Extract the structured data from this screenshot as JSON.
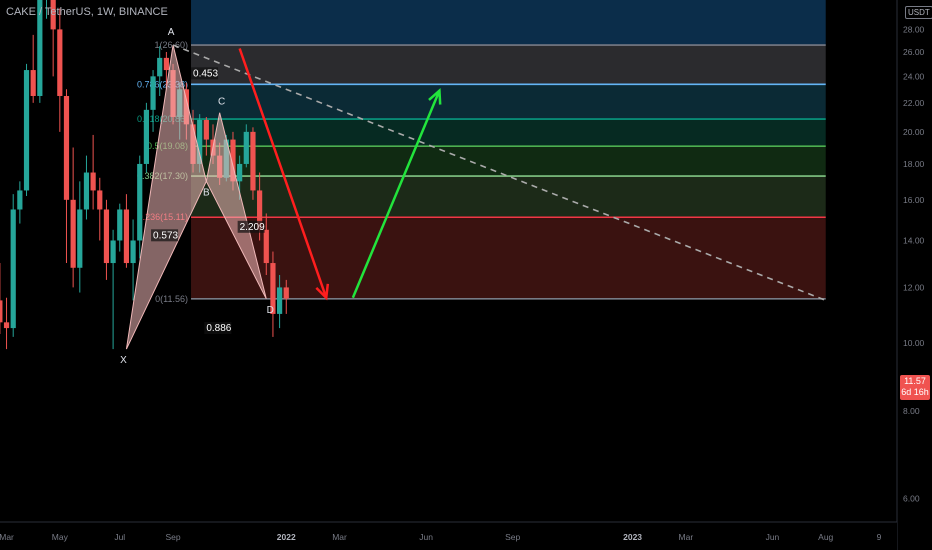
{
  "header": {
    "symbol": "CAKE / TetherUS, 1W, BINANCE"
  },
  "price_axis": {
    "currency": "USDT",
    "current_price": "11.57",
    "countdown": "6d 16h"
  },
  "chart_data": {
    "type": "candlestick",
    "ylim": [
      5.0,
      28.5
    ],
    "y_ticks": [
      6,
      8,
      10,
      12,
      14,
      16,
      18,
      20,
      22,
      24,
      26,
      28
    ],
    "y_tick_labels": [
      "6.00",
      "8.00",
      "10.00",
      "12.00",
      "14.00",
      "16.00",
      "18.00",
      "20.00",
      "22.00",
      "24.00",
      "26.00",
      "28.00"
    ],
    "x_ticks": [
      {
        "label": "Mar",
        "week": -31
      },
      {
        "label": "May",
        "week": -23
      },
      {
        "label": "Jul",
        "week": -14
      },
      {
        "label": "Sep",
        "week": -6
      },
      {
        "label": "2022",
        "week": 11
      },
      {
        "label": "Mar",
        "week": 19
      },
      {
        "label": "Jun",
        "week": 32
      },
      {
        "label": "Sep",
        "week": 45
      },
      {
        "label": "2023",
        "week": 63
      },
      {
        "label": "Mar",
        "week": 71
      },
      {
        "label": "Jun",
        "week": 84
      },
      {
        "label": "Aug",
        "week": 92
      },
      {
        "label": "9",
        "week": 100
      }
    ],
    "colors": {
      "up": "#26a69a",
      "down": "#ef5350",
      "harmonic_fill": "#f0b8b8",
      "down_arrow": "#ff1e1e",
      "up_arrow": "#22e43c",
      "trendline": "#aaaaaa"
    },
    "candles": [
      {
        "o": 9.5,
        "h": 11.5,
        "l": 8.8,
        "c": 13.5
      },
      {
        "o": 13.5,
        "h": 16.0,
        "l": 8.5,
        "c": 10.0
      },
      {
        "o": 10.0,
        "h": 12.0,
        "l": 9.3,
        "c": 11.5
      },
      {
        "o": 11.5,
        "h": 13.0,
        "l": 10.3,
        "c": 10.7
      },
      {
        "o": 10.7,
        "h": 11.6,
        "l": 9.8,
        "c": 10.5
      },
      {
        "o": 10.5,
        "h": 16.3,
        "l": 10.2,
        "c": 15.5
      },
      {
        "o": 15.5,
        "h": 17.0,
        "l": 14.8,
        "c": 16.5
      },
      {
        "o": 16.5,
        "h": 25.0,
        "l": 16.2,
        "c": 24.5
      },
      {
        "o": 24.5,
        "h": 27.5,
        "l": 22.0,
        "c": 22.5
      },
      {
        "o": 22.5,
        "h": 34.0,
        "l": 22.0,
        "c": 33.0
      },
      {
        "o": 33.0,
        "h": 44.0,
        "l": 29.0,
        "c": 43.0
      },
      {
        "o": 43.0,
        "h": 44.0,
        "l": 24.0,
        "c": 28.0
      },
      {
        "o": 28.0,
        "h": 30.0,
        "l": 20.0,
        "c": 22.5
      },
      {
        "o": 22.5,
        "h": 23.0,
        "l": 13.0,
        "c": 16.0
      },
      {
        "o": 16.0,
        "h": 19.0,
        "l": 12.0,
        "c": 12.8
      },
      {
        "o": 12.8,
        "h": 17.0,
        "l": 11.8,
        "c": 15.5
      },
      {
        "o": 15.5,
        "h": 18.5,
        "l": 15.0,
        "c": 17.5
      },
      {
        "o": 17.5,
        "h": 19.8,
        "l": 15.5,
        "c": 16.5
      },
      {
        "o": 16.5,
        "h": 17.2,
        "l": 14.0,
        "c": 15.5
      },
      {
        "o": 15.5,
        "h": 16.0,
        "l": 12.3,
        "c": 13.0
      },
      {
        "o": 13.0,
        "h": 14.5,
        "l": 9.8,
        "c": 14.0
      },
      {
        "o": 14.0,
        "h": 15.8,
        "l": 13.5,
        "c": 15.5
      },
      {
        "o": 15.5,
        "h": 16.3,
        "l": 12.8,
        "c": 13.0
      },
      {
        "o": 13.0,
        "h": 15.0,
        "l": 11.5,
        "c": 14.0
      },
      {
        "o": 14.0,
        "h": 18.5,
        "l": 13.2,
        "c": 18.0
      },
      {
        "o": 18.0,
        "h": 22.0,
        "l": 17.5,
        "c": 21.5
      },
      {
        "o": 21.5,
        "h": 24.5,
        "l": 20.0,
        "c": 24.0
      },
      {
        "o": 24.0,
        "h": 26.5,
        "l": 22.5,
        "c": 25.5
      },
      {
        "o": 25.5,
        "h": 26.0,
        "l": 23.0,
        "c": 24.5
      },
      {
        "o": 24.5,
        "h": 25.0,
        "l": 20.5,
        "c": 21.0
      },
      {
        "o": 21.0,
        "h": 23.5,
        "l": 19.5,
        "c": 23.0
      },
      {
        "o": 23.0,
        "h": 23.5,
        "l": 19.5,
        "c": 20.5
      },
      {
        "o": 20.5,
        "h": 21.5,
        "l": 17.5,
        "c": 18.0
      },
      {
        "o": 18.0,
        "h": 21.2,
        "l": 17.5,
        "c": 20.8
      },
      {
        "o": 20.8,
        "h": 21.0,
        "l": 18.5,
        "c": 19.5
      },
      {
        "o": 19.5,
        "h": 20.5,
        "l": 18.0,
        "c": 18.5
      },
      {
        "o": 18.5,
        "h": 19.3,
        "l": 16.8,
        "c": 17.2
      },
      {
        "o": 17.2,
        "h": 19.8,
        "l": 17.0,
        "c": 19.5
      },
      {
        "o": 19.5,
        "h": 20.0,
        "l": 16.5,
        "c": 17.0
      },
      {
        "o": 17.0,
        "h": 18.5,
        "l": 16.0,
        "c": 18.0
      },
      {
        "o": 18.0,
        "h": 20.5,
        "l": 17.8,
        "c": 20.0
      },
      {
        "o": 20.0,
        "h": 20.3,
        "l": 16.0,
        "c": 16.5
      },
      {
        "o": 16.5,
        "h": 17.5,
        "l": 14.0,
        "c": 14.5
      },
      {
        "o": 14.5,
        "h": 15.3,
        "l": 12.5,
        "c": 13.0
      },
      {
        "o": 13.0,
        "h": 13.5,
        "l": 10.2,
        "c": 11.0
      },
      {
        "o": 11.0,
        "h": 12.5,
        "l": 10.5,
        "c": 12.0
      },
      {
        "o": 12.0,
        "h": 12.3,
        "l": 11.0,
        "c": 11.57
      }
    ],
    "fib_levels": [
      {
        "ratio": 1,
        "price": 26.6,
        "label": "1(26.60)",
        "color": "#787b86",
        "fill": "#0b2d4a"
      },
      {
        "ratio": 0.786,
        "price": 23.38,
        "label": "0.786(23.38)",
        "color": "#64b5f6",
        "fill": "#2b2b2e"
      },
      {
        "ratio": 0.618,
        "price": 20.86,
        "label": "0.618(20.86)",
        "color": "#089981",
        "fill": "#0b2a35"
      },
      {
        "ratio": 0.5,
        "price": 19.08,
        "label": "0.5(19.08)",
        "color": "#4caf50",
        "fill": "#062a22"
      },
      {
        "ratio": 0.382,
        "price": 17.3,
        "label": "0.382(17.30)",
        "color": "#81c784",
        "fill": "#102a12"
      },
      {
        "ratio": 0.236,
        "price": 15.11,
        "label": "0.236(15.11)",
        "color": "#f23645",
        "fill": "#1c2a18"
      },
      {
        "ratio": 0,
        "price": 11.56,
        "label": "0(11.56)",
        "color": "#787b86",
        "fill": "#3a1210"
      }
    ],
    "fib_extends_to_week": 92,
    "harmonic": {
      "points": [
        {
          "label": "X",
          "week": -13,
          "price": 9.8
        },
        {
          "label": "A",
          "week": -6,
          "price": 26.6
        },
        {
          "label": "B",
          "week": -1,
          "price": 17.0
        },
        {
          "label": "C",
          "week": 1,
          "price": 21.3
        },
        {
          "label": "D",
          "week": 8,
          "price": 11.56
        }
      ],
      "ratios": [
        {
          "text": "0.573",
          "week": -9,
          "price": 14.1
        },
        {
          "text": "0.453",
          "week": -3,
          "price": 24.0
        },
        {
          "text": "2.209",
          "week": 4,
          "price": 14.5
        },
        {
          "text": "0.886",
          "week": -1,
          "price": 10.4
        }
      ]
    },
    "trendline": {
      "start": {
        "week": -6,
        "price": 26.6
      },
      "end": {
        "week": 92,
        "price": 11.5
      }
    },
    "arrows": [
      {
        "dir": "down",
        "start": {
          "week": 4,
          "price": 26.3
        },
        "end": {
          "week": 17,
          "price": 11.6
        }
      },
      {
        "dir": "up",
        "start": {
          "week": 21,
          "price": 11.6
        },
        "end": {
          "week": 34,
          "price": 22.9
        }
      }
    ]
  }
}
